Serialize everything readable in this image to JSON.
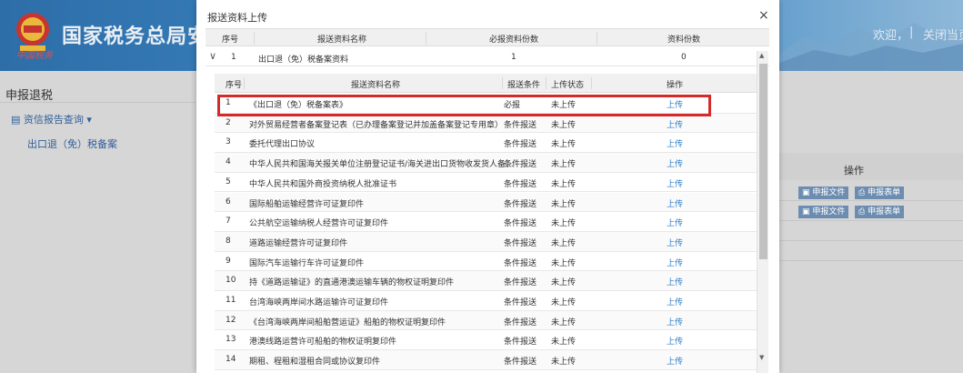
{
  "header": {
    "site_title": "国家税务总局安徽",
    "slogan": "中国税务",
    "welcome": "欢迎，",
    "separator": "|",
    "close": "关闭当页"
  },
  "sidebar": {
    "title": "申报退税",
    "menu": "资信报告查询",
    "submenu": "出口退（免）税备案"
  },
  "background_table": {
    "op_header": "操作",
    "rows": [
      {
        "file_btn": "申报文件",
        "form_btn": "申报表单"
      },
      {
        "file_btn": "申报文件",
        "form_btn": "申报表单"
      }
    ]
  },
  "modal": {
    "title": "报送资料上传",
    "close": "×",
    "outer_columns": [
      "序号",
      "报送资料名称",
      "必报资料份数",
      "资料份数"
    ],
    "outer_row": {
      "expand": "∨",
      "no": "1",
      "name": "出口退（免）税备案资料",
      "required": "1",
      "count": "0"
    },
    "inner_columns": [
      "序号",
      "报送资料名称",
      "报送条件",
      "上传状态",
      "操作"
    ],
    "inner_rows": [
      {
        "no": "1",
        "name": "《出口退（免）税备案表》",
        "cond": "必报",
        "status": "未上传",
        "op": "上传"
      },
      {
        "no": "2",
        "name": "对外贸易经营者备案登记表（已办理备案登记并加盖备案登记专用章）",
        "cond": "条件报送",
        "status": "未上传",
        "op": "上传"
      },
      {
        "no": "3",
        "name": "委托代理出口协议",
        "cond": "条件报送",
        "status": "未上传",
        "op": "上传"
      },
      {
        "no": "4",
        "name": "中华人民共和国海关报关单位注册登记证书/海关进出口货物收发货人备...",
        "cond": "条件报送",
        "status": "未上传",
        "op": "上传"
      },
      {
        "no": "5",
        "name": "中华人民共和国外商投资纳税人批准证书",
        "cond": "条件报送",
        "status": "未上传",
        "op": "上传"
      },
      {
        "no": "6",
        "name": "国际船舶运输经营许可证复印件",
        "cond": "条件报送",
        "status": "未上传",
        "op": "上传"
      },
      {
        "no": "7",
        "name": "公共航空运输纳税人经营许可证复印件",
        "cond": "条件报送",
        "status": "未上传",
        "op": "上传"
      },
      {
        "no": "8",
        "name": "道路运输经营许可证复印件",
        "cond": "条件报送",
        "status": "未上传",
        "op": "上传"
      },
      {
        "no": "9",
        "name": "国际汽车运输行车许可证复印件",
        "cond": "条件报送",
        "status": "未上传",
        "op": "上传"
      },
      {
        "no": "10",
        "name": "持《道路运输证》的直通港澳运输车辆的物权证明复印件",
        "cond": "条件报送",
        "status": "未上传",
        "op": "上传"
      },
      {
        "no": "11",
        "name": "台湾海峡两岸间水路运输许可证复印件",
        "cond": "条件报送",
        "status": "未上传",
        "op": "上传"
      },
      {
        "no": "12",
        "name": "《台湾海峡两岸间船舶营运证》船舶的物权证明复印件",
        "cond": "条件报送",
        "status": "未上传",
        "op": "上传"
      },
      {
        "no": "13",
        "name": "港澳线路运营许可船舶的物权证明复印件",
        "cond": "条件报送",
        "status": "未上传",
        "op": "上传"
      },
      {
        "no": "14",
        "name": "期租、程租和湿租合同或协议复印件",
        "cond": "条件报送",
        "status": "未上传",
        "op": "上传"
      }
    ]
  },
  "scrollbar": {
    "up": "▲",
    "down": "▼"
  }
}
